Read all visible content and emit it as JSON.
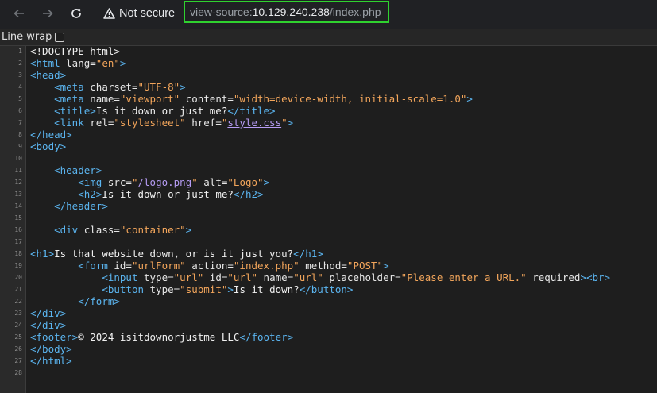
{
  "browser": {
    "security_label": "Not secure",
    "url_prefix": "view-source:",
    "url_host": "10.129.240.238",
    "url_path": "/index.php"
  },
  "toolbar": {
    "line_wrap_label": "Line wrap",
    "line_wrap_checked": false
  },
  "source": {
    "lines": [
      {
        "n": "1",
        "parts": [
          [
            "txt",
            "<!DOCTYPE html>"
          ]
        ]
      },
      {
        "n": "2",
        "parts": [
          [
            "t",
            "<html "
          ],
          [
            "a",
            "lang="
          ],
          [
            "v",
            "\"en\""
          ],
          [
            "t",
            ">"
          ]
        ]
      },
      {
        "n": "3",
        "parts": [
          [
            "t",
            "<head>"
          ]
        ]
      },
      {
        "n": "4",
        "parts": [
          [
            "txt",
            "    "
          ],
          [
            "t",
            "<meta "
          ],
          [
            "a",
            "charset="
          ],
          [
            "v",
            "\"UTF-8\""
          ],
          [
            "t",
            ">"
          ]
        ]
      },
      {
        "n": "5",
        "parts": [
          [
            "txt",
            "    "
          ],
          [
            "t",
            "<meta "
          ],
          [
            "a",
            "name="
          ],
          [
            "v",
            "\"viewport\""
          ],
          [
            "a",
            " content="
          ],
          [
            "v",
            "\"width=device-width, initial-scale=1.0\""
          ],
          [
            "t",
            ">"
          ]
        ]
      },
      {
        "n": "6",
        "parts": [
          [
            "txt",
            "    "
          ],
          [
            "t",
            "<title>"
          ],
          [
            "txt",
            "Is it down or just me?"
          ],
          [
            "t",
            "</title>"
          ]
        ]
      },
      {
        "n": "7",
        "parts": [
          [
            "txt",
            "    "
          ],
          [
            "t",
            "<link "
          ],
          [
            "a",
            "rel="
          ],
          [
            "v",
            "\"stylesheet\""
          ],
          [
            "a",
            " href="
          ],
          [
            "v",
            "\""
          ],
          [
            "lk",
            "style.css"
          ],
          [
            "v",
            "\""
          ],
          [
            "t",
            ">"
          ]
        ]
      },
      {
        "n": "8",
        "parts": [
          [
            "t",
            "</head>"
          ]
        ]
      },
      {
        "n": "9",
        "parts": [
          [
            "t",
            "<body>"
          ]
        ]
      },
      {
        "n": "10",
        "parts": []
      },
      {
        "n": "11",
        "parts": [
          [
            "txt",
            "    "
          ],
          [
            "t",
            "<header>"
          ]
        ]
      },
      {
        "n": "12",
        "parts": [
          [
            "txt",
            "        "
          ],
          [
            "t",
            "<img "
          ],
          [
            "a",
            "src="
          ],
          [
            "v",
            "\""
          ],
          [
            "lk",
            "/logo.png"
          ],
          [
            "v",
            "\""
          ],
          [
            "a",
            " alt="
          ],
          [
            "v",
            "\"Logo\""
          ],
          [
            "t",
            ">"
          ]
        ]
      },
      {
        "n": "13",
        "parts": [
          [
            "txt",
            "        "
          ],
          [
            "t",
            "<h2>"
          ],
          [
            "txt",
            "Is it down or just me?"
          ],
          [
            "t",
            "</h2>"
          ]
        ]
      },
      {
        "n": "14",
        "parts": [
          [
            "txt",
            "    "
          ],
          [
            "t",
            "</header>"
          ]
        ]
      },
      {
        "n": "15",
        "parts": []
      },
      {
        "n": "16",
        "parts": [
          [
            "txt",
            "    "
          ],
          [
            "t",
            "<div "
          ],
          [
            "a",
            "class="
          ],
          [
            "v",
            "\"container\""
          ],
          [
            "t",
            ">"
          ]
        ]
      },
      {
        "n": "17",
        "parts": []
      },
      {
        "n": "18",
        "parts": [
          [
            "t",
            "<h1>"
          ],
          [
            "txt",
            "Is that website down, or is it just you?"
          ],
          [
            "t",
            "</h1>"
          ]
        ]
      },
      {
        "n": "19",
        "parts": [
          [
            "txt",
            "        "
          ],
          [
            "t",
            "<form "
          ],
          [
            "a",
            "id="
          ],
          [
            "v",
            "\"urlForm\""
          ],
          [
            "a",
            " action="
          ],
          [
            "v",
            "\"index.php\""
          ],
          [
            "a",
            " method="
          ],
          [
            "v",
            "\"POST\""
          ],
          [
            "t",
            ">"
          ]
        ]
      },
      {
        "n": "20",
        "parts": [
          [
            "txt",
            "            "
          ],
          [
            "t",
            "<input "
          ],
          [
            "a",
            "type="
          ],
          [
            "v",
            "\"url\""
          ],
          [
            "a",
            " id="
          ],
          [
            "v",
            "\"url\""
          ],
          [
            "a",
            " name="
          ],
          [
            "v",
            "\"url\""
          ],
          [
            "a",
            " placeholder="
          ],
          [
            "v",
            "\"Please enter a URL.\""
          ],
          [
            "a",
            " required"
          ],
          [
            "t",
            ">"
          ],
          [
            "t",
            "<br>"
          ]
        ]
      },
      {
        "n": "21",
        "parts": [
          [
            "txt",
            "            "
          ],
          [
            "t",
            "<button "
          ],
          [
            "a",
            "type="
          ],
          [
            "v",
            "\"submit\""
          ],
          [
            "t",
            ">"
          ],
          [
            "txt",
            "Is it down?"
          ],
          [
            "t",
            "</button>"
          ]
        ]
      },
      {
        "n": "22",
        "parts": [
          [
            "txt",
            "        "
          ],
          [
            "t",
            "</form>"
          ]
        ]
      },
      {
        "n": "23",
        "parts": [
          [
            "t",
            "</div>"
          ]
        ]
      },
      {
        "n": "24",
        "parts": [
          [
            "t",
            "</div>"
          ]
        ]
      },
      {
        "n": "25",
        "parts": [
          [
            "t",
            "<footer>"
          ],
          [
            "txt",
            "© 2024 isitdownorjustme LLC"
          ],
          [
            "t",
            "</footer>"
          ]
        ]
      },
      {
        "n": "26",
        "parts": [
          [
            "t",
            "</body>"
          ]
        ]
      },
      {
        "n": "27",
        "parts": [
          [
            "t",
            "</html>"
          ]
        ]
      },
      {
        "n": "28",
        "parts": []
      }
    ]
  },
  "colors": {
    "tag": "#5bb5f0",
    "attr_value": "#f2a55b",
    "link": "#b69cf4",
    "url_highlight_border": "#2fd22f"
  }
}
